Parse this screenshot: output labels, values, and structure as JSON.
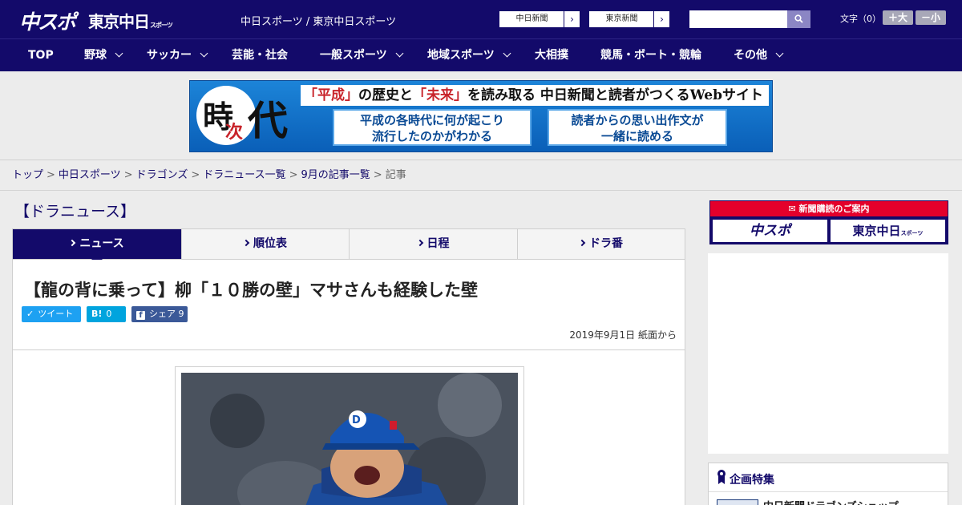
{
  "header": {
    "logo_main": "中スポ",
    "logo_tokyo": "東京中日",
    "logo_tokyo_small": "スポーツ",
    "site_name": "中日スポーツ / 東京中日スポーツ",
    "link_chunichi": "中日新聞",
    "link_tokyo": "東京新聞",
    "font_label": "文字（0）",
    "font_plus": "＋大",
    "font_minus": "－小"
  },
  "nav": {
    "items": [
      {
        "label": "TOP",
        "has_menu": false
      },
      {
        "label": "野球",
        "has_menu": true
      },
      {
        "label": "サッカー",
        "has_menu": true
      },
      {
        "label": "芸能・社会",
        "has_menu": false
      },
      {
        "label": "一般スポーツ",
        "has_menu": true
      },
      {
        "label": "地域スポーツ",
        "has_menu": true
      },
      {
        "label": "大相撲",
        "has_menu": false
      },
      {
        "label": "競馬・ボート・競輪",
        "has_menu": false
      },
      {
        "label": "その他",
        "has_menu": true
      }
    ]
  },
  "banner": {
    "ji": "時",
    "ji2": "次",
    "dai": "代",
    "head_q1": "「平成」",
    "head_t1": "の歴史と",
    "head_q2": "「未来」",
    "head_t2": "を読み取る 中日新聞と読者がつくるWebサイト",
    "box1_l1": "平成の各時代に何が起こり",
    "box1_l2": "流行したのかがわかる",
    "box2_l1": "読者からの思い出作文が",
    "box2_l2": "一緒に読める"
  },
  "breadcrumb": {
    "items": [
      "トップ",
      "中日スポーツ",
      "ドラゴンズ",
      "ドラニュース一覧",
      "9月の記事一覧"
    ],
    "current": "記事"
  },
  "main": {
    "section_title": "【ドラニュース】",
    "tabs": [
      "ニュース",
      "順位表",
      "日程",
      "ドラ番"
    ],
    "active_tab": 0,
    "headline": "【龍の背に乗って】柳「１０勝の壁」マサさんも経験した壁",
    "share": {
      "tweet_label": "ツイート",
      "hatena_label": "B!",
      "hatena_count": "0",
      "facebook_label": "シェア",
      "facebook_count": "9"
    },
    "dateline": "2019年9月1日 紙面から"
  },
  "sidebar": {
    "subscribe_title": "新聞購読のご案内",
    "subscribe_logo1": "中スポ",
    "subscribe_logo2": "東京中日",
    "subscribe_logo2_small": "スポーツ",
    "special_title": "企画特集",
    "special_item": "中日新聞ドラゴンズショップ"
  },
  "colors": {
    "brand_navy": "#130a6a",
    "twitter": "#1da1f2",
    "hatena": "#00a4de",
    "facebook": "#3b5998",
    "subscribe_red": "#e4002b"
  }
}
